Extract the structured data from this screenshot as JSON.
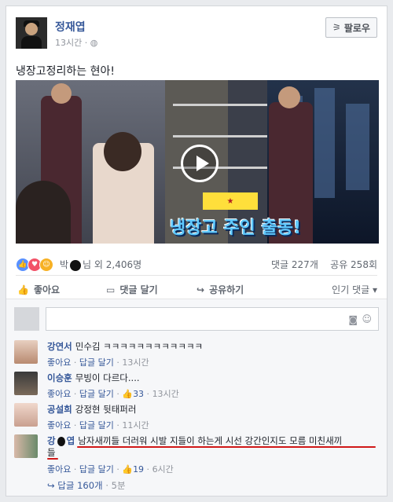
{
  "post": {
    "author": "정재엽",
    "time": "13시간",
    "follow_label": "팔로우",
    "caption": "냉장고정리하는 현아!",
    "video": {
      "overlay_text": "냉장고 주인 출동!"
    }
  },
  "reactions": {
    "names_prefix": "박",
    "names_suffix": "님 외 2,406명",
    "comments_count": "댓글 227개",
    "shares_count": "공유 258회"
  },
  "actions": {
    "like": "좋아요",
    "comment": "댓글 달기",
    "share": "공유하기",
    "sort": "인기 댓글 ▾"
  },
  "comments": [
    {
      "name": "강연서",
      "text": "민수김 ㅋㅋㅋㅋㅋㅋㅋㅋㅋㅋㅋㅋ",
      "like": "좋아요",
      "reply": "답글 달기",
      "likes_count": "",
      "time": "13시간"
    },
    {
      "name": "이승훈",
      "text": "무빙이 다르다....",
      "like": "좋아요",
      "reply": "답글 달기",
      "likes_count": "33",
      "time": "13시간"
    },
    {
      "name": "공설희",
      "text": "강정현 뒷태퍼러",
      "like": "좋아요",
      "reply": "답글 달기",
      "likes_count": "",
      "time": "11시간"
    },
    {
      "name": "강",
      "name_suffix": "엽",
      "text": "남자새끼들 더러워 시발 지들이 하는게 시선 강간인지도 모름 미친새끼",
      "text2": "들",
      "like": "좋아요",
      "reply": "답글 달기",
      "likes_count": "19",
      "time": "6시간"
    }
  ],
  "replies": {
    "label": "답글 160개",
    "time": "5분"
  },
  "colors": {
    "link": "#365899",
    "muted": "#90949c",
    "underline": "#d01818"
  }
}
